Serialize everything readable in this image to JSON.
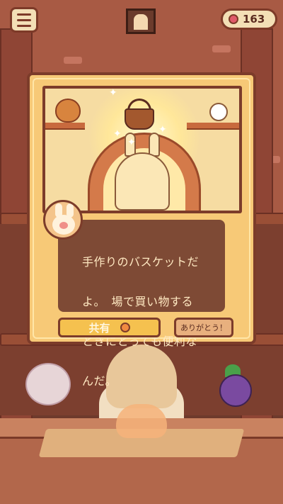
{
  "hud": {
    "menu_icon": "hamburger-menu-icon",
    "portrait_icon": "portrait-icon",
    "hearts_icon": "heart-icon",
    "hearts_count": "163"
  },
  "dialog": {
    "message": "手作りのバスケットだよ。　場で買い物するときにとっても便利なんだ。",
    "message_lines": [
      "手作りのバスケットだ",
      "よ。　場で買い物する",
      "ときにとっても便利な",
      "んだ。"
    ],
    "share_label": "共有",
    "thanks_label": "ありがとう！",
    "share_icon": "share-icon",
    "item_icon": "basket-icon",
    "speaker_icon": "bunny-avatar-icon"
  },
  "colors": {
    "dialog_bg": "#f7c977",
    "dialog_border": "#7c3c2a",
    "text_box": "#7e4a35",
    "text": "#ffe9c2",
    "share_button": "#f5c14f",
    "thanks_button": "#e8b07e"
  }
}
